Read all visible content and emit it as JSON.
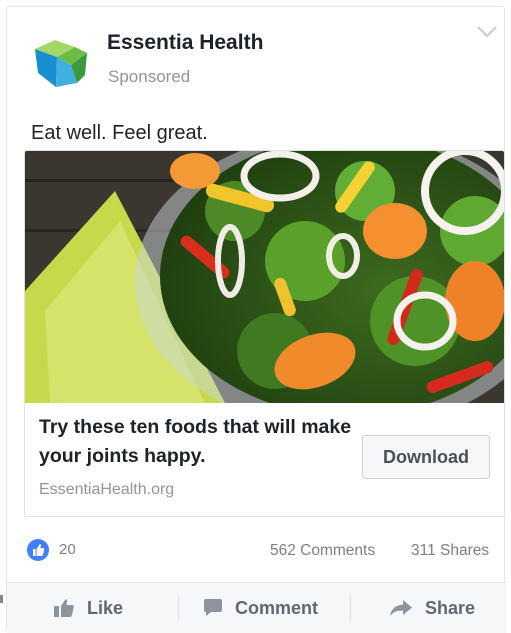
{
  "post": {
    "page_name": "Essentia Health",
    "sponsored_label": "Sponsored",
    "text": "Eat well. Feel great."
  },
  "ad": {
    "headline": "Try these ten foods that will make your joints happy.",
    "domain": "EssentiaHealth.org",
    "cta_label": "Download"
  },
  "stats": {
    "likes": "20",
    "comments": "562 Comments",
    "shares": "311 Shares"
  },
  "actions": {
    "like": "Like",
    "comment": "Comment",
    "share": "Share"
  },
  "colors": {
    "like_badge": "#4080ff",
    "logo_blue": "#1f8fd0",
    "logo_green": "#7cc243"
  },
  "icons": [
    "essentia-health-logo",
    "chevron-down-icon",
    "like-badge-icon",
    "thumbs-up-icon",
    "comment-icon",
    "share-icon"
  ]
}
